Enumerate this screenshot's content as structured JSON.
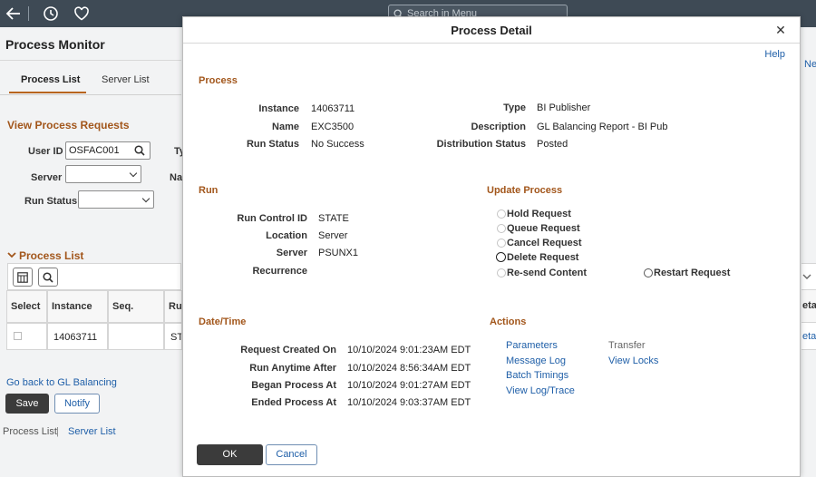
{
  "topbar": {
    "search_placeholder": "Search in Menu"
  },
  "background": {
    "page_title": "Process Monitor",
    "tabs": [
      "Process List",
      "Server List"
    ],
    "view_section": "View Process Requests",
    "user_id_label": "User ID",
    "user_id_value": "OSFAC001",
    "type_label_partial": "Ty",
    "name_label_partial": "Na",
    "server_label": "Server",
    "run_status_label": "Run Status",
    "process_list_header": "Process List",
    "grid_columns": [
      "Select",
      "Instance",
      "Seq.",
      "Ru"
    ],
    "grid_row": {
      "instance": "14063711",
      "run_partial": "STA"
    },
    "right_edge_partial": "Ne",
    "right_edge_column_partial": "eta",
    "right_edge_cell_partial": "eta",
    "go_back_link": "Go back to GL Balancing",
    "save_button": "Save",
    "notify_button": "Notify",
    "footer_links": [
      "Process List",
      "Server List"
    ],
    "footer_separator": "|"
  },
  "modal": {
    "title": "Process Detail",
    "help_link": "Help",
    "process_section": {
      "heading": "Process",
      "instance_label": "Instance",
      "instance_value": "14063711",
      "name_label": "Name",
      "name_value": "EXC3500",
      "run_status_label": "Run Status",
      "run_status_value": "No Success",
      "type_label": "Type",
      "type_value": "BI Publisher",
      "description_label": "Description",
      "description_value": "GL Balancing Report - BI Pub",
      "distribution_label": "Distribution Status",
      "distribution_value": "Posted"
    },
    "run_section": {
      "heading": "Run",
      "run_control_label": "Run Control ID",
      "run_control_value": "STATE",
      "location_label": "Location",
      "location_value": "Server",
      "server_label": "Server",
      "server_value": "PSUNX1",
      "recurrence_label": "Recurrence",
      "recurrence_value": ""
    },
    "update_process": {
      "heading": "Update Process",
      "options": [
        "Hold Request",
        "Queue Request",
        "Cancel Request",
        "Delete Request",
        "Re-send Content",
        "Restart Request"
      ]
    },
    "datetime_section": {
      "heading": "Date/Time",
      "request_created_label": "Request Created On",
      "request_created_date": "10/10/2024",
      "request_created_time": "9:01:23AM EDT",
      "run_anytime_label": "Run Anytime After",
      "run_anytime_date": "10/10/2024",
      "run_anytime_time": "8:56:34AM EDT",
      "began_label": "Began Process At",
      "began_date": "10/10/2024",
      "began_time": "9:01:27AM EDT",
      "ended_label": "Ended Process At",
      "ended_date": "10/10/2024",
      "ended_time": "9:03:37AM EDT"
    },
    "actions": {
      "heading": "Actions",
      "parameters": "Parameters",
      "message_log": "Message Log",
      "batch_timings": "Batch Timings",
      "view_log_trace": "View Log/Trace",
      "transfer": "Transfer",
      "view_locks": "View Locks"
    },
    "ok_button": "OK",
    "cancel_button": "Cancel"
  }
}
